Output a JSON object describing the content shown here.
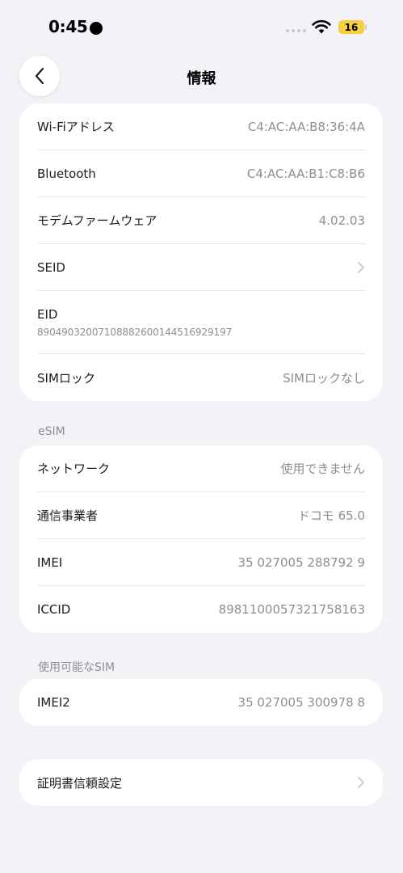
{
  "status_bar": {
    "time": "0:45",
    "battery": "16",
    "battery_color": "#f4d03f"
  },
  "header": {
    "title": "情報",
    "back_icon": "chevron-left-icon"
  },
  "device_info": [
    {
      "label": "Wi-Fiアドレス",
      "value": "C4:AC:AA:B8:36:4A"
    },
    {
      "label": "Bluetooth",
      "value": "C4:AC:AA:B1:C8:B6"
    },
    {
      "label": "モデムファームウェア",
      "value": "4.02.03"
    },
    {
      "label": "SEID",
      "icon": "chevron-right-icon"
    },
    {
      "label": "EID",
      "value": "89049032007108882600144516929197"
    },
    {
      "label": "SIMロック",
      "value": "SIMロックなし"
    }
  ],
  "esim": {
    "header": "eSIM",
    "rows": [
      {
        "label": "ネットワーク",
        "value": "使用できません"
      },
      {
        "label": "通信事業者",
        "value": "ドコモ 65.0"
      },
      {
        "label": "IMEI",
        "value": "35 027005 288792 9"
      },
      {
        "label": "ICCID",
        "value": "8981100057321758163"
      }
    ]
  },
  "available_sim": {
    "header": "使用可能なSIM",
    "rows": [
      {
        "label": "IMEI2",
        "value": "35 027005 300978 8"
      }
    ]
  },
  "certificate": {
    "label": "証明書信頼設定",
    "icon": "chevron-right-icon"
  }
}
